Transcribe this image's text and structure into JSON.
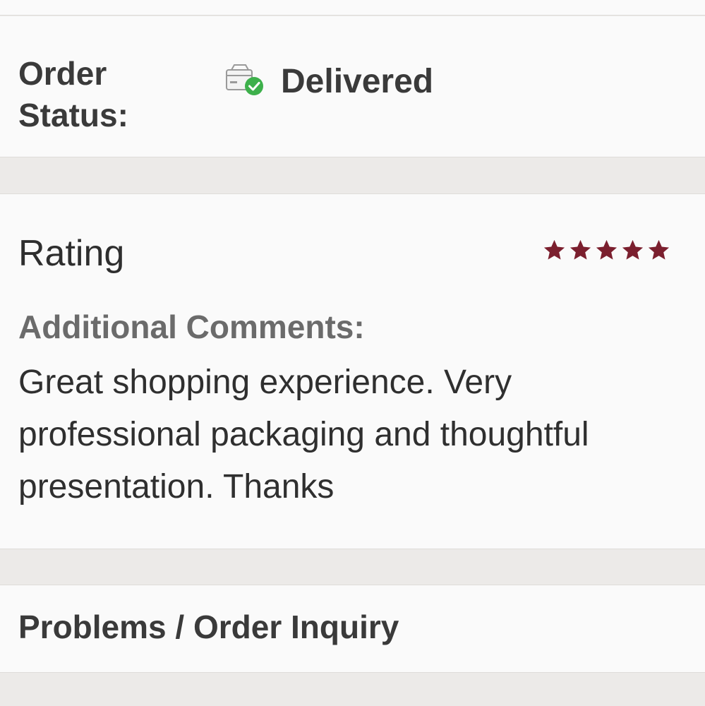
{
  "order_status": {
    "label": "Order Status:",
    "value": "Delivered",
    "icon": "delivered-box-check-icon",
    "status_color": "#3db04b"
  },
  "rating": {
    "heading": "Rating",
    "stars": 5,
    "max_stars": 5,
    "star_color": "#7b1f2e",
    "comments_label": "Additional Comments:",
    "comments_text": "Great shopping experience. Very professional packaging and thoughtful presentation. Thanks"
  },
  "problems": {
    "label": "Problems / Order Inquiry"
  }
}
